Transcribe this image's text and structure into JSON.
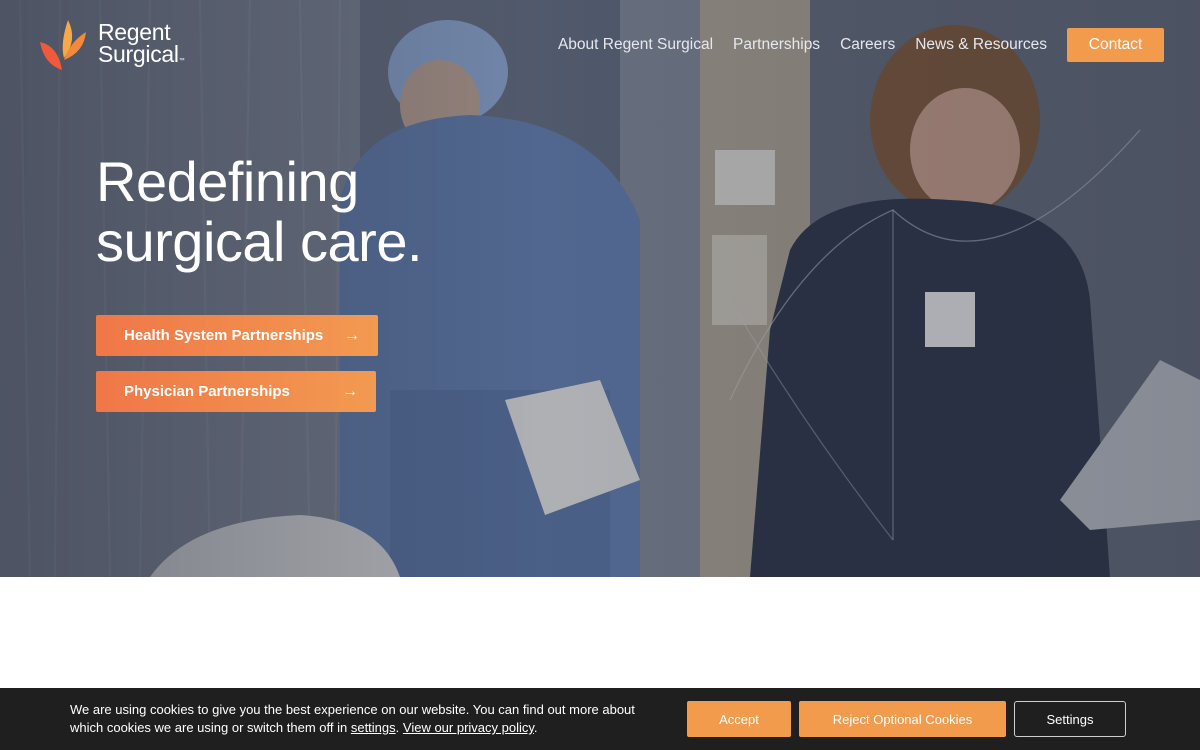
{
  "brand": {
    "name_line1": "Regent",
    "name_line2": "Surgical",
    "trademark": "™",
    "accent_color": "#f29b4d",
    "logo_icon": "regent-surgical-logo-mark"
  },
  "nav": {
    "items": [
      {
        "label": "About Regent Surgical"
      },
      {
        "label": "Partnerships"
      },
      {
        "label": "Careers"
      },
      {
        "label": "News & Resources"
      }
    ],
    "contact_label": "Contact"
  },
  "hero": {
    "headline_line1": "Redefining",
    "headline_line2": "surgical care.",
    "cta_primary": "Health System Partnerships",
    "cta_secondary": "Physician Partnerships",
    "arrow_icon": "→"
  },
  "cookie": {
    "text_part1": "We are using cookies to give you the best experience on our website. You can find out more about which cookies we are using or switch them off in ",
    "settings_link": "settings",
    "text_part2": ". ",
    "privacy_link": "View our privacy policy",
    "text_part3": ".",
    "accept_label": "Accept",
    "reject_label": "Reject Optional Cookies",
    "settings_label": "Settings"
  }
}
